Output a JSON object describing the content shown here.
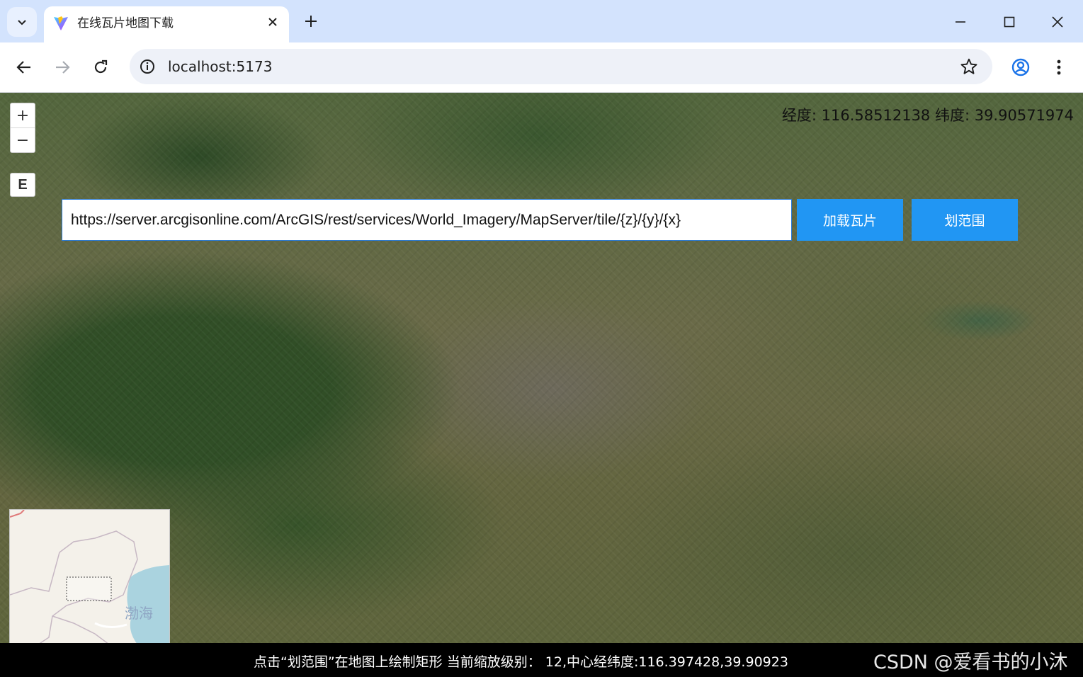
{
  "browser": {
    "tab_title": "在线瓦片地图下载",
    "address": "localhost:5173",
    "icons": [
      "tab-search-icon",
      "vite-logo-icon",
      "close-icon",
      "plus-icon",
      "minimize-icon",
      "maximize-icon",
      "close-window-icon",
      "back-arrow-icon",
      "forward-arrow-icon",
      "reload-icon",
      "info-icon",
      "star-icon",
      "profile-icon",
      "more-vert-icon"
    ]
  },
  "map": {
    "zoom_in": "+",
    "zoom_out": "−",
    "extent_button": "E",
    "coords_readout": "经度: 116.58512138 纬度: 39.90571974",
    "tile_url": "https://server.arcgisonline.com/ArcGIS/rest/services/World_Imagery/MapServer/tile/{z}/{y}/{x}",
    "load_button": "加载瓦片",
    "draw_button": "划范围",
    "overview_label": "渤海",
    "status": "点击“划范围”在地图上绘制矩形 当前缩放级别：  12,中心经纬度:116.397428,39.90923",
    "watermark": "CSDN @爱看书的小沐",
    "colors": {
      "button_blue": "#2196f3",
      "input_border": "#2a7bd8",
      "status_bg": "#000000"
    }
  }
}
